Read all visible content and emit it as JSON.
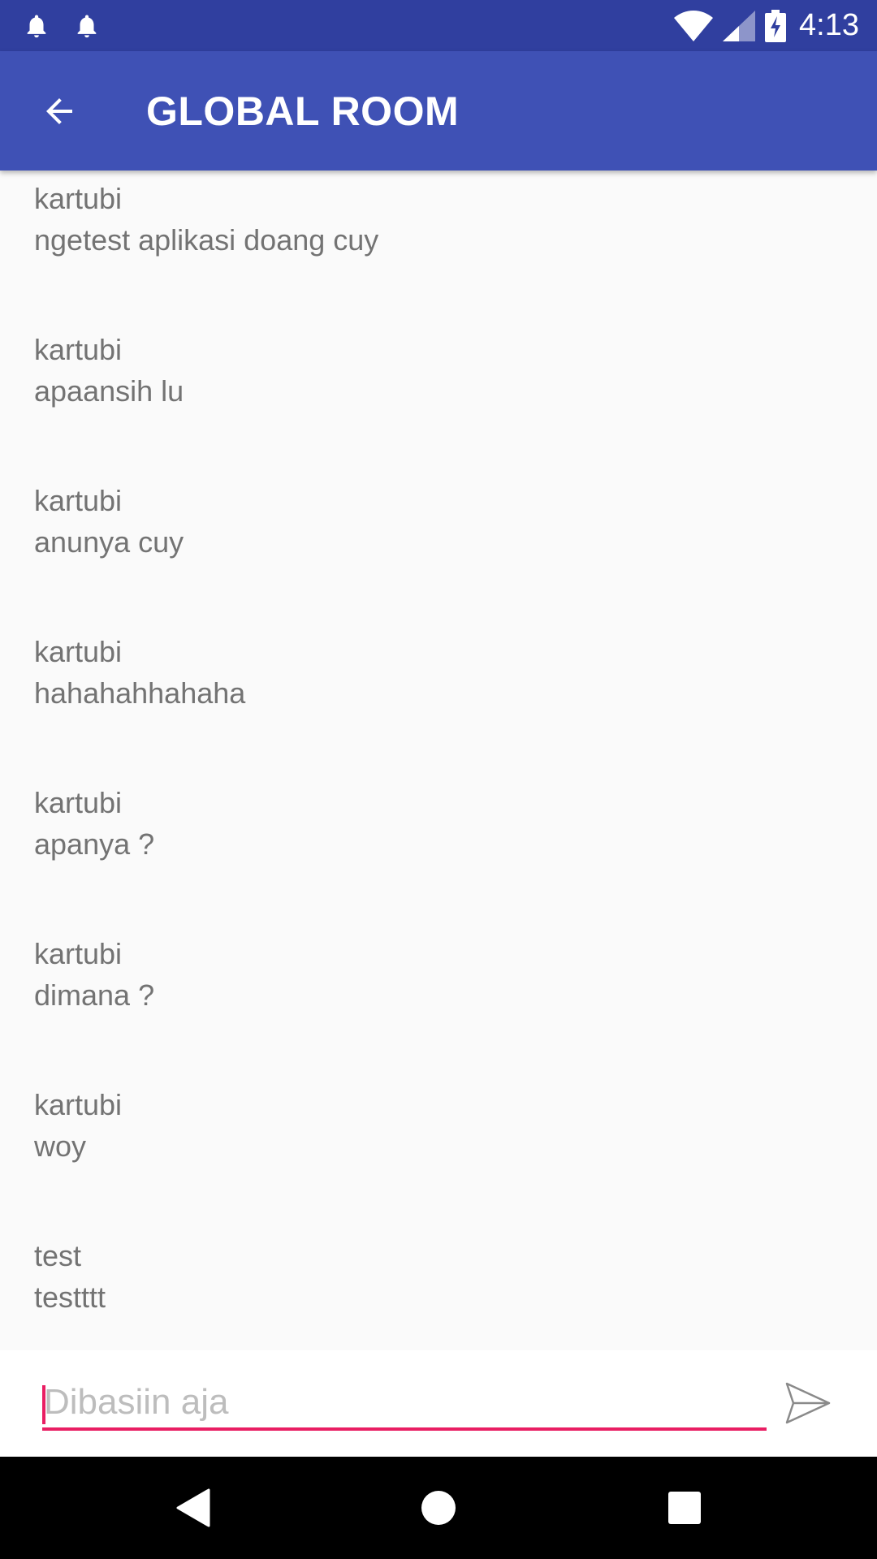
{
  "status_bar": {
    "time": "4:13",
    "icons": [
      "notification-bell-icon",
      "notification-bell-icon",
      "wifi-icon",
      "cell-signal-icon",
      "battery-charging-icon"
    ]
  },
  "app_bar": {
    "title": "GLOBAL ROOM",
    "back_icon": "arrow-back-icon"
  },
  "messages": [
    {
      "sender": "kartubi",
      "text": "ngetest aplikasi doang cuy"
    },
    {
      "sender": "kartubi",
      "text": "apaansih lu"
    },
    {
      "sender": "kartubi",
      "text": "anunya cuy"
    },
    {
      "sender": "kartubi",
      "text": "hahahahhahaha"
    },
    {
      "sender": "kartubi",
      "text": "apanya ?"
    },
    {
      "sender": "kartubi",
      "text": "dimana ?"
    },
    {
      "sender": "kartubi",
      "text": "woy"
    },
    {
      "sender": "test",
      "text": "testttt"
    }
  ],
  "input": {
    "value": "",
    "placeholder": "Dibasiin aja",
    "send_icon": "send-icon"
  },
  "nav_bar": {
    "icons": [
      "nav-back-icon",
      "nav-home-icon",
      "nav-recents-icon"
    ]
  },
  "colors": {
    "status_bar": "#303f9f",
    "app_bar": "#3f51b5",
    "accent": "#e91e63",
    "message_text": "#737373",
    "background": "#fafafa"
  }
}
